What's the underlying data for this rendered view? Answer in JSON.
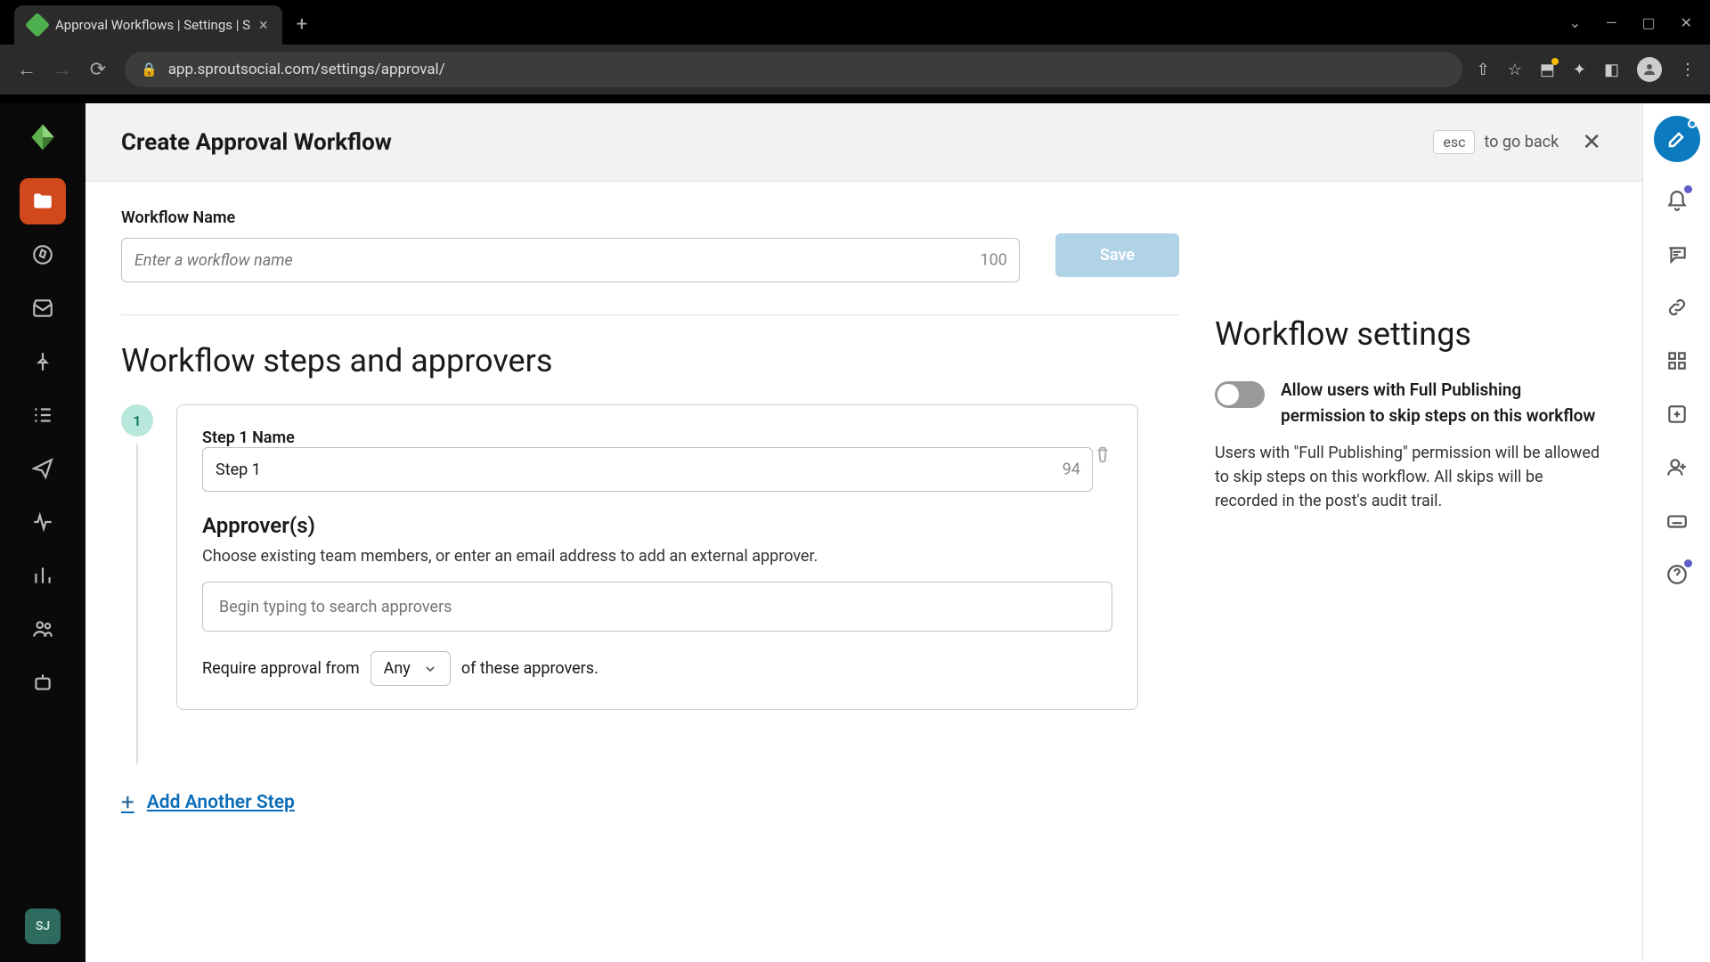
{
  "browser": {
    "tab_title": "Approval Workflows | Settings | S",
    "url": "app.sproutsocial.com/settings/approval/"
  },
  "header": {
    "title": "Create Approval Workflow",
    "esc_key": "esc",
    "esc_hint": "to go back"
  },
  "workflow_name": {
    "label": "Workflow Name",
    "placeholder": "Enter a workflow name",
    "char_count": "100"
  },
  "save_button": "Save",
  "steps_section": {
    "title": "Workflow steps and approvers",
    "step_number": "1",
    "step_name_label": "Step 1 Name",
    "step_name_value": "Step 1",
    "step_name_count": "94",
    "approvers_title": "Approver(s)",
    "approvers_help": "Choose existing team members, or enter an email address to add an external approver.",
    "approvers_placeholder": "Begin typing to search approvers",
    "require_prefix": "Require approval from",
    "require_select": "Any",
    "require_suffix": "of these approvers.",
    "add_step": "Add Another Step"
  },
  "settings": {
    "title": "Workflow settings",
    "toggle_label": "Allow users with Full Publishing permission to skip steps on this workflow",
    "toggle_desc": "Users with \"Full Publishing\" permission will be allowed to skip steps on this workflow. All skips will be recorded in the post's audit trail."
  },
  "user_initials": "SJ"
}
